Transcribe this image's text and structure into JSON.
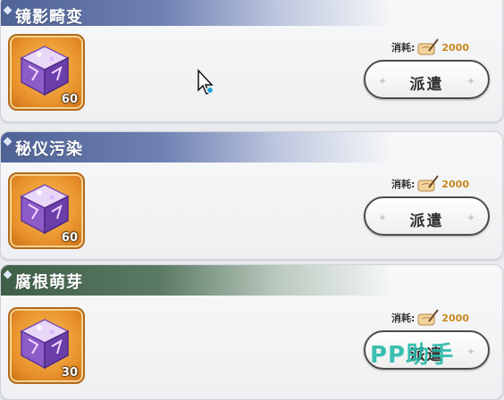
{
  "missions": [
    {
      "title": "镜影畸变",
      "item_count": "60",
      "cost_label": "消耗:",
      "cost_value": "2000",
      "button_label": "派遣",
      "header_color": "#4f6295"
    },
    {
      "title": "秘仪污染",
      "item_count": "60",
      "cost_label": "消耗:",
      "cost_value": "2000",
      "button_label": "派遣",
      "header_color": "#4f6295"
    },
    {
      "title": "腐根萌芽",
      "item_count": "30",
      "cost_label": "消耗:",
      "cost_value": "2000",
      "button_label": "派遣",
      "header_color": "#3e5e48"
    }
  ],
  "cost_icon": "scroll-quill-icon",
  "item_icon": "crystal-cube-icon",
  "watermark": "PP助手",
  "colors": {
    "accent_gold": "#c9881e",
    "watermark": "#22b8a8"
  }
}
